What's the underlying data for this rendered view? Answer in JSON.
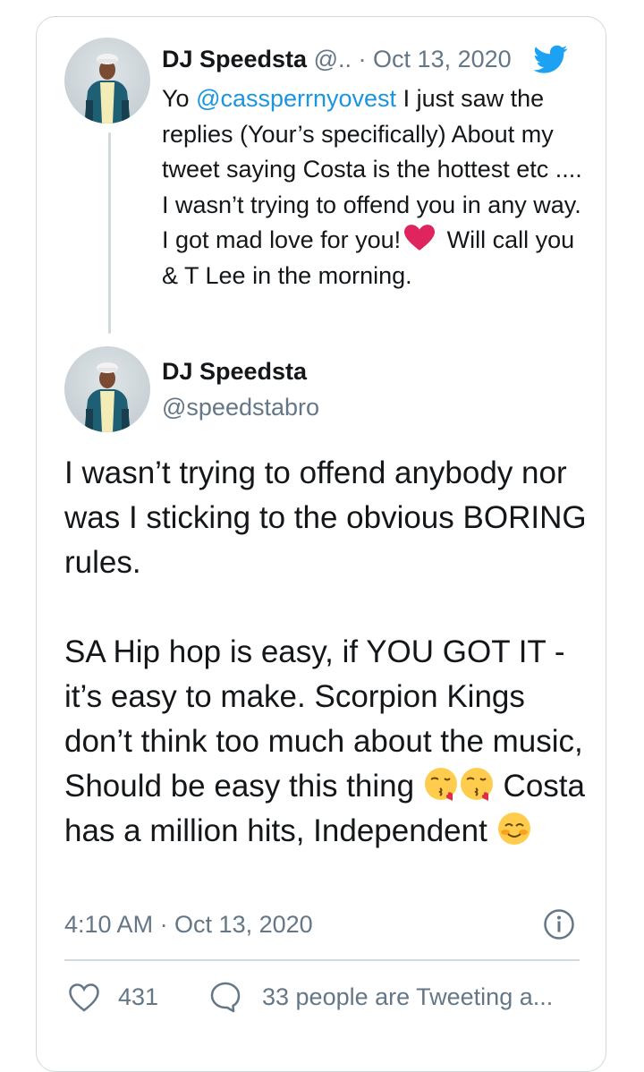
{
  "quoted_tweet": {
    "display_name": "DJ Speedsta",
    "handle_truncated": "@..",
    "separator": "·",
    "date": "Oct 13, 2020",
    "text_prefix": "Yo ",
    "mention": "@cassperrnyovest",
    "text_part1": " I just saw the replies (Your’s specifically) About my tweet saying Costa is the hottest etc .... I wasn’t trying to offend you in any way. I got mad love for you!",
    "text_part2": " Will call you & T Lee in the morning.",
    "emoji": "red-heart"
  },
  "main_tweet": {
    "display_name": "DJ Speedsta",
    "handle": "@speedstabro",
    "paragraph1": "I wasn’t trying to offend anybody nor was I sticking to the obvious BORING rules.",
    "paragraph2_part1": "SA Hip hop is easy, if YOU GOT IT - it’s easy to make. Scorpion Kings don’t think too much about the music, Should be easy this thing ",
    "paragraph2_part2": " Costa has a million hits, Independent ",
    "emojis": [
      "face-blowing-kiss",
      "face-blowing-kiss",
      "smiling-face"
    ]
  },
  "meta": {
    "timestamp": "4:10 AM · Oct 13, 2020"
  },
  "actions": {
    "like_count": "431",
    "tweeting_text": "33 people are Tweeting a..."
  },
  "colors": {
    "link": "#1b95e0",
    "muted": "#657786",
    "border": "#cfd9de",
    "twitter_blue": "#1da1f2",
    "heart_red": "#e0245e"
  }
}
